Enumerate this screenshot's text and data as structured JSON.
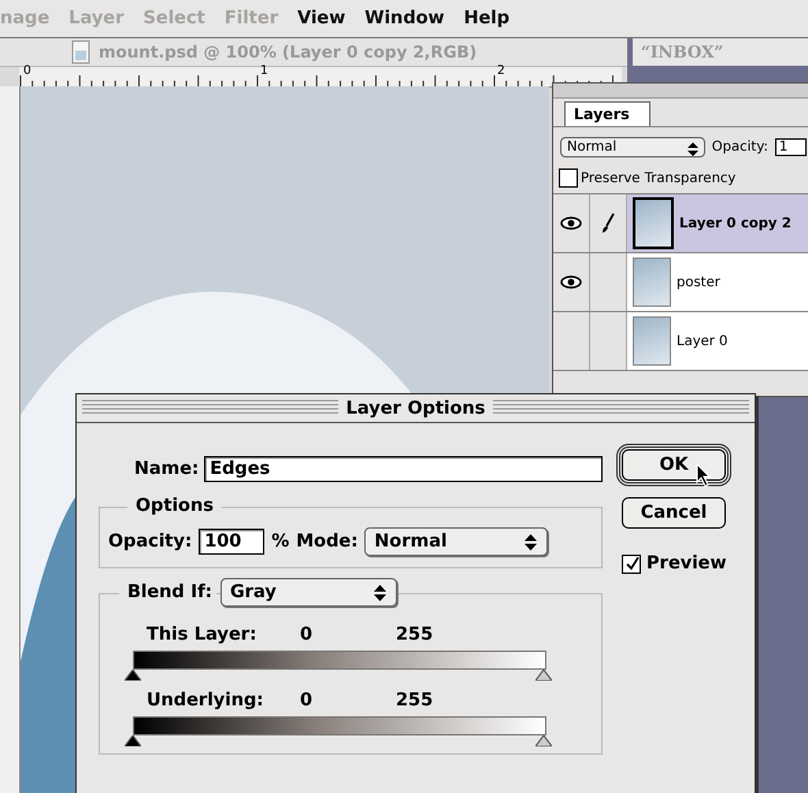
{
  "menu_bar": {
    "items": [
      {
        "label": "nage",
        "disabled": true
      },
      {
        "label": "Layer",
        "disabled": true
      },
      {
        "label": "Select",
        "disabled": true
      },
      {
        "label": "Filter",
        "disabled": true
      },
      {
        "label": "View",
        "disabled": false
      },
      {
        "label": "Window",
        "disabled": false
      },
      {
        "label": "Help",
        "disabled": false
      }
    ]
  },
  "document_window": {
    "title": "mount.psd @ 100% (Layer 0 copy 2,RGB)",
    "ruler_labels": [
      "0",
      "1",
      "2"
    ]
  },
  "mail_window": {
    "title": "“INBOX”"
  },
  "layers_palette": {
    "tab": "Layers",
    "blend_mode": "Normal",
    "opacity_label": "Opacity:",
    "opacity_value": "1",
    "preserve_transparency": {
      "label": "Preserve Transparency",
      "checked": false
    },
    "layers": [
      {
        "name": "Layer 0 copy 2",
        "visible": true,
        "editing": true,
        "selected": true
      },
      {
        "name": "poster",
        "visible": true,
        "editing": false,
        "selected": false
      },
      {
        "name": "Layer 0",
        "visible": false,
        "editing": false,
        "selected": false
      }
    ]
  },
  "dialog": {
    "title": "Layer Options",
    "name_label": "Name:",
    "name_value": "Edges",
    "options_label": "Options",
    "opacity_label": "Opacity:",
    "opacity_value": "100",
    "percent": "%",
    "mode_label": "Mode:",
    "mode_value": "Normal",
    "buttons": [
      {
        "label": "OK",
        "default": true
      },
      {
        "label": "Cancel",
        "default": false
      }
    ],
    "preview": {
      "label": "Preview",
      "checked": true
    },
    "blend_if_label": "Blend If:",
    "blend_if_value": "Gray",
    "sliders": [
      {
        "label": "This Layer:",
        "low": "0",
        "high": "255",
        "thumbs": [
          {
            "level": 0
          },
          {
            "level": 1
          }
        ]
      },
      {
        "label": "Underlying:",
        "low": "0",
        "high": "255",
        "thumbs": [
          {
            "level": 0
          },
          {
            "level": 1
          }
        ]
      }
    ]
  }
}
